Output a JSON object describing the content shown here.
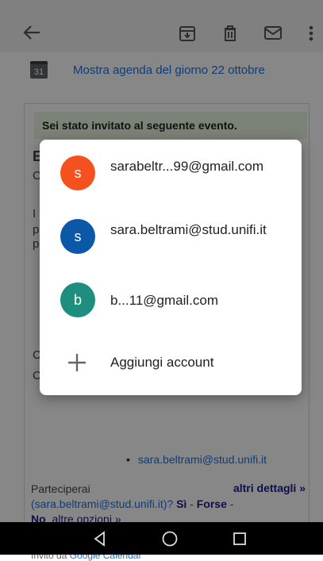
{
  "appbar": {
    "icons": [
      "back-arrow-icon",
      "archive-icon",
      "delete-icon",
      "mail-icon",
      "more-vert-icon"
    ]
  },
  "email": {
    "calendar_date": "31",
    "agenda_link": "Mostra agenda del giorno 22 ottobre",
    "invite_banner": "Sei stato invitato al seguente evento.",
    "guest": "sara.beltrami@stud.unifi.it",
    "rsvp_question": "Parteciperai",
    "rsvp_email": "(sara.beltrami@stud.unifi.it)?",
    "rsvp_yes": "Sì",
    "rsvp_sep1": "-",
    "rsvp_maybe": "Forse",
    "rsvp_sep2": "-",
    "rsvp_no": "No",
    "rsvp_other": "altre opzioni »",
    "more_details": "altri dettagli »",
    "footer_prefix": "Invito da",
    "footer_link": "Google Calendar"
  },
  "account_dialog": {
    "accounts": [
      {
        "initial": "s",
        "color": "#f4511e",
        "email": "sarabeltr...99@gmail.com"
      },
      {
        "initial": "s",
        "color": "#0b57a8",
        "email": "sara.beltrami@stud.unifi.it"
      },
      {
        "initial": "b",
        "color": "#1e8e7e",
        "email": "b...11@gmail.com"
      }
    ],
    "add_account": "Aggiungi account"
  },
  "navbar": {
    "icons": [
      "back-triangle-icon",
      "home-circle-icon",
      "recents-square-icon"
    ]
  }
}
